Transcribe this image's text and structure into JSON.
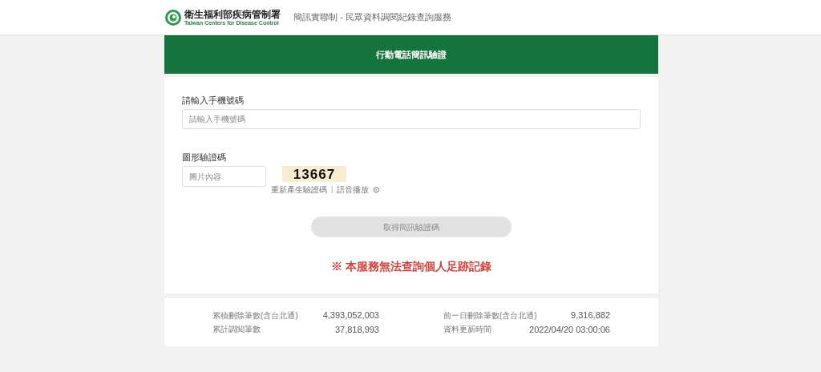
{
  "header": {
    "logo_title": "衛生福利部疾病管制署",
    "logo_subtitle": "Taiwan Centers for Disease Control",
    "site_title": "簡訊實聯制 - 民眾資料調閱紀錄查詢服務"
  },
  "banner": {
    "title": "行動電話簡訊驗證"
  },
  "phone": {
    "label": "請輸入手機號碼",
    "placeholder": "請輸入手機號碼"
  },
  "captcha": {
    "label": "圖形驗證碼",
    "placeholder": "圖片內容",
    "code": "13667",
    "refresh": "重新產生驗證碼",
    "separator": "|",
    "audio": "語音播放",
    "audio_icon": "⊙"
  },
  "submit": {
    "label": "取得簡訊驗證碼",
    "disabled": true
  },
  "notice": "※ 本服務無法查詢個人足跡記錄",
  "stats": [
    {
      "label": "累積刪除筆數(含台北通)",
      "value": "4,393,052,003"
    },
    {
      "label": "前一日刪除筆數(含台北通)",
      "value": "9,316,882"
    },
    {
      "label": "累計調閱筆數",
      "value": "37,818,993"
    },
    {
      "label": "資料更新時間",
      "value": "2022/04/20 03:00:06"
    }
  ]
}
